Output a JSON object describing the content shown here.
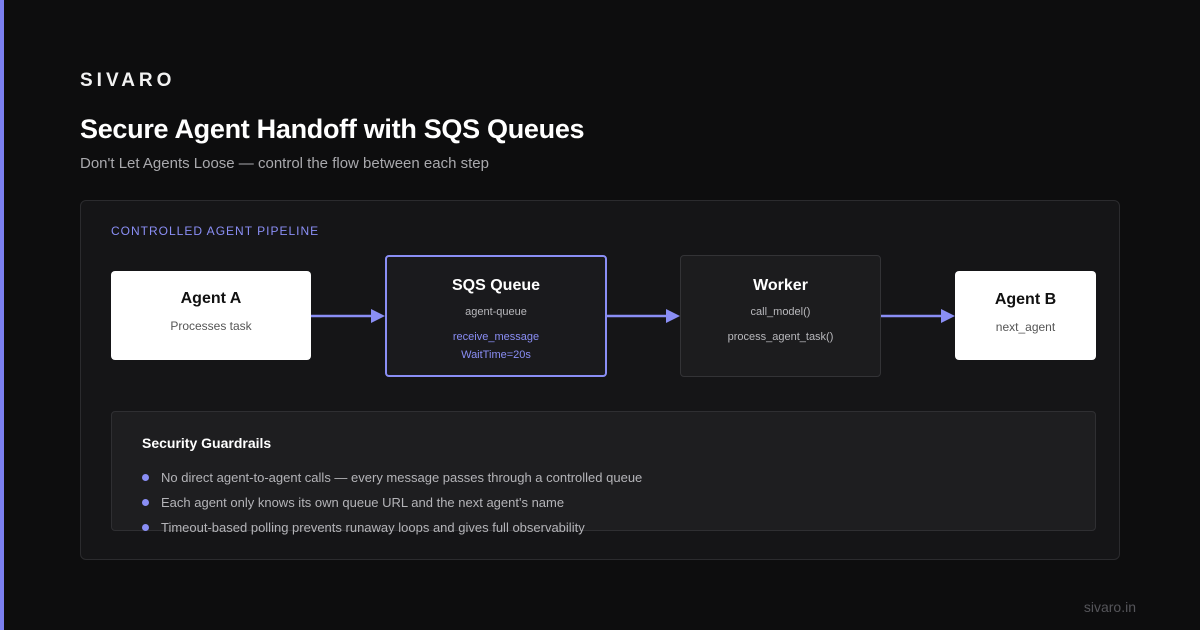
{
  "brand": "SIVARO",
  "title": "Secure Agent Handoff with SQS Queues",
  "subtitle": "Don't Let Agents Loose — control the flow between each step",
  "pipeline": {
    "label": "CONTROLLED AGENT PIPELINE",
    "agent_a": {
      "title": "Agent A",
      "line1": "Processes task"
    },
    "queue": {
      "title": "SQS Queue",
      "line1": "agent-queue",
      "line2": "receive_message",
      "line3": "WaitTime=20s"
    },
    "worker": {
      "title": "Worker",
      "line1": "call_model()",
      "line2": "process_agent_task()"
    },
    "agent_b": {
      "title": "Agent B",
      "line1": "next_agent"
    }
  },
  "guardrails": {
    "title": "Security Guardrails",
    "items": [
      "No direct agent-to-agent calls — every message passes through a controlled queue",
      "Each agent only knows its own queue URL and the next agent's name",
      "Timeout-based polling prevents runaway loops and gives full observability"
    ]
  },
  "footer": "sivaro.in",
  "colors": {
    "accent": "#8a8ef5",
    "background": "#0d0d0e",
    "panel": "#151517"
  }
}
